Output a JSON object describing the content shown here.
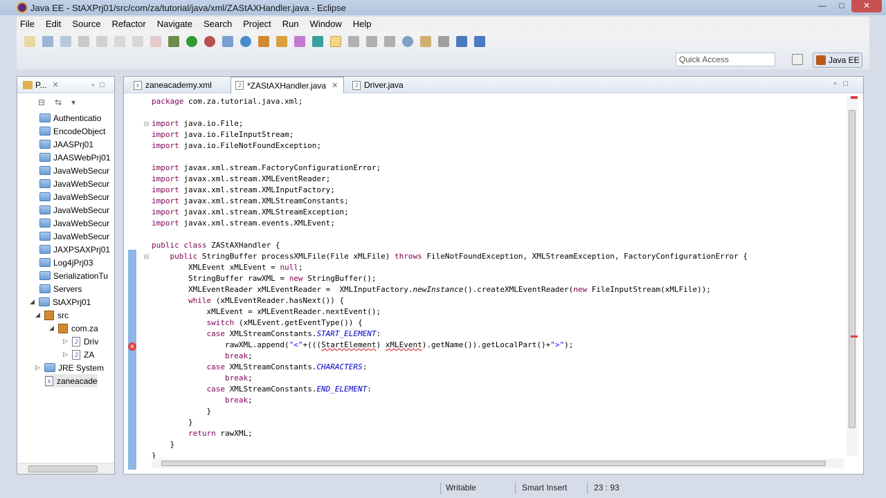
{
  "window": {
    "title": "Java EE - StAXPrj01/src/com/za/tutorial/java/xml/ZAStAXHandler.java - Eclipse"
  },
  "menu": [
    "File",
    "Edit",
    "Source",
    "Refactor",
    "Navigate",
    "Search",
    "Project",
    "Run",
    "Window",
    "Help"
  ],
  "toolbar": {
    "quick_access_placeholder": "Quick Access",
    "perspective": "Java EE"
  },
  "explorer": {
    "tab_label": "P...",
    "items": [
      {
        "label": "Authenticatio",
        "kind": "folder",
        "depth": 0
      },
      {
        "label": "EncodeObject",
        "kind": "folder",
        "depth": 0
      },
      {
        "label": "JAASPrj01",
        "kind": "folder",
        "depth": 0
      },
      {
        "label": "JAASWebPrj01",
        "kind": "folder",
        "depth": 0
      },
      {
        "label": "JavaWebSecur",
        "kind": "folder",
        "depth": 0
      },
      {
        "label": "JavaWebSecur",
        "kind": "folder",
        "depth": 0
      },
      {
        "label": "JavaWebSecur",
        "kind": "folder",
        "depth": 0
      },
      {
        "label": "JavaWebSecur",
        "kind": "folder",
        "depth": 0
      },
      {
        "label": "JavaWebSecur",
        "kind": "folder",
        "depth": 0
      },
      {
        "label": "JavaWebSecur",
        "kind": "folder",
        "depth": 0
      },
      {
        "label": "JAXPSAXPrj01",
        "kind": "folder",
        "depth": 0
      },
      {
        "label": "Log4jPrj03",
        "kind": "folder",
        "depth": 0
      },
      {
        "label": "SerializationTu",
        "kind": "folder",
        "depth": 0
      },
      {
        "label": "Servers",
        "kind": "folder",
        "depth": 0
      },
      {
        "label": "StAXPrj01",
        "kind": "project",
        "depth": 0
      },
      {
        "label": "src",
        "kind": "src",
        "depth": 1
      },
      {
        "label": "com.za",
        "kind": "package",
        "depth": 2
      },
      {
        "label": "Driv",
        "kind": "java",
        "depth": 3
      },
      {
        "label": "ZA",
        "kind": "java",
        "depth": 3
      },
      {
        "label": "JRE System",
        "kind": "library",
        "depth": 1
      },
      {
        "label": "zaneacade",
        "kind": "xml",
        "depth": 1
      }
    ]
  },
  "editor": {
    "tabs": [
      {
        "label": "zaneacademy.xml",
        "active": false
      },
      {
        "label": "*ZAStAXHandler.java",
        "active": true
      },
      {
        "label": "Driver.java",
        "active": false
      }
    ]
  },
  "status": {
    "writable": "Writable",
    "insert_mode": "Smart Insert",
    "position": "23 : 93"
  },
  "colors": {
    "keyword": "#7f0055",
    "string": "#2a00ff",
    "constant": "#0000c0",
    "gutter_highlight": "#8fb6e6",
    "error_marker": "#e03030"
  }
}
